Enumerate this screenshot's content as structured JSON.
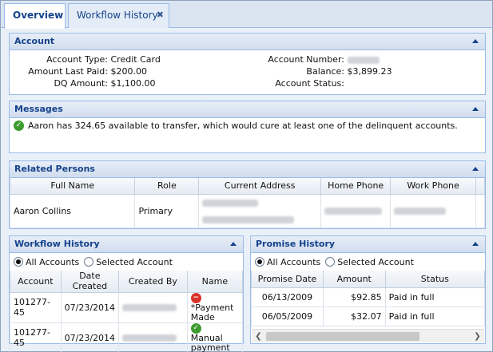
{
  "tabs": [
    {
      "label": "Overview"
    },
    {
      "label": "Workflow History",
      "close": "✖"
    }
  ],
  "account": {
    "title": "Account",
    "account_type_label": "Account Type:",
    "account_type": "Credit Card",
    "last_paid_label": "Amount Last Paid:",
    "last_paid": "$200.00",
    "dq_label": "DQ Amount:",
    "dq": "$1,100.00",
    "acct_number_label": "Account Number:",
    "balance_label": "Balance:",
    "balance": "$3,899.23",
    "status_label": "Account Status:"
  },
  "messages": {
    "title": "Messages",
    "text": "Aaron has 324.65 available to transfer, which would cure at least one of the delinquent accounts."
  },
  "related": {
    "title": "Related Persons",
    "columns": [
      "Full Name",
      "Role",
      "Current Address",
      "Home Phone",
      "Work Phone"
    ],
    "row": {
      "name": "Aaron Collins",
      "role": "Primary"
    }
  },
  "workflow": {
    "title": "Workflow History",
    "radio_all": "All Accounts",
    "radio_selected": "Selected Account",
    "columns": [
      "Account",
      "Date Created",
      "Created By",
      "Name"
    ],
    "rows": [
      {
        "account": "101277-45",
        "date": "07/23/2014",
        "name": "*Payment Made",
        "status": "minus"
      },
      {
        "account": "101277-45",
        "date": "07/23/2014",
        "name": "Manual payment",
        "status": "check"
      }
    ]
  },
  "promise": {
    "title": "Promise History",
    "radio_all": "All Accounts",
    "radio_selected": "Selected Account",
    "columns": [
      "Promise Date",
      "Amount",
      "Status"
    ],
    "rows": [
      {
        "date": "06/13/2009",
        "amount": "$92.85",
        "status": "Paid in full"
      },
      {
        "date": "06/05/2009",
        "amount": "$32.07",
        "status": "Paid in full"
      }
    ]
  }
}
